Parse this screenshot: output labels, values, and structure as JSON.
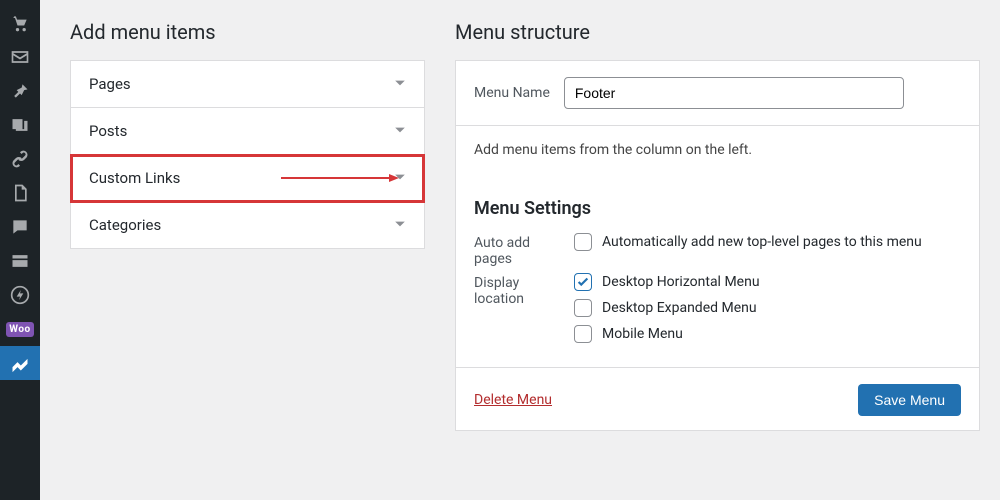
{
  "adminbar": {
    "items": [
      "cart",
      "mail",
      "pin",
      "media",
      "link",
      "pages",
      "comment",
      "block",
      "bolt",
      "woo",
      "tool"
    ]
  },
  "left": {
    "title": "Add menu items",
    "accordion": [
      {
        "label": "Pages"
      },
      {
        "label": "Posts"
      },
      {
        "label": "Custom Links",
        "highlight": true
      },
      {
        "label": "Categories"
      }
    ]
  },
  "right": {
    "title": "Menu structure",
    "menu_name_label": "Menu Name",
    "menu_name_value": "Footer",
    "hint": "Add menu items from the column on the left.",
    "settings_heading": "Menu Settings",
    "auto_add_label": "Auto add pages",
    "auto_add_option": "Automatically add new top-level pages to this menu",
    "display_label": "Display location",
    "locations": [
      {
        "label": "Desktop Horizontal Menu",
        "checked": true
      },
      {
        "label": "Desktop Expanded Menu",
        "checked": false
      },
      {
        "label": "Mobile Menu",
        "checked": false
      }
    ],
    "delete": "Delete Menu",
    "save": "Save Menu"
  }
}
